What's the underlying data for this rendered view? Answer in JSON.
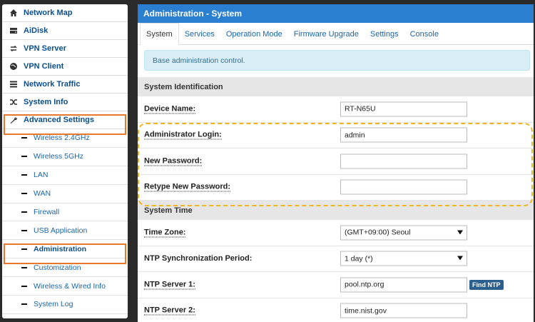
{
  "sidebar": {
    "items": [
      {
        "label": "Network Map",
        "icon": "home-icon"
      },
      {
        "label": "AiDisk",
        "icon": "disk-icon"
      },
      {
        "label": "VPN Server",
        "icon": "vpn-server-icon"
      },
      {
        "label": "VPN Client",
        "icon": "globe-icon"
      },
      {
        "label": "Network Traffic",
        "icon": "traffic-icon"
      },
      {
        "label": "System Info",
        "icon": "shuffle-icon"
      },
      {
        "label": "Advanced Settings",
        "icon": "wrench-icon"
      }
    ],
    "subitems": [
      {
        "label": "Wireless 2.4GHz"
      },
      {
        "label": "Wireless 5GHz"
      },
      {
        "label": "LAN"
      },
      {
        "label": "WAN"
      },
      {
        "label": "Firewall"
      },
      {
        "label": "USB Application"
      },
      {
        "label": "Administration"
      },
      {
        "label": "Customization"
      },
      {
        "label": "Wireless & Wired Info"
      },
      {
        "label": "System Log"
      }
    ]
  },
  "main": {
    "title": "Administration - System",
    "tabs": [
      "System",
      "Services",
      "Operation Mode",
      "Firmware Upgrade",
      "Settings",
      "Console"
    ],
    "info": "Base administration control.",
    "section1": "System Identification",
    "device_name_label": "Device Name:",
    "device_name_value": "RT-N65U",
    "admin_login_label": "Administrator Login:",
    "admin_login_value": "admin",
    "new_password_label": "New Password:",
    "retype_password_label": "Retype New Password:",
    "section2": "System Time",
    "timezone_label": "Time Zone:",
    "timezone_value": "(GMT+09:00) Seoul",
    "ntp_period_label": "NTP Synchronization Period:",
    "ntp_period_value": "1 day (*)",
    "ntp1_label": "NTP Server 1:",
    "ntp1_value": "pool.ntp.org",
    "find_ntp": "Find NTP",
    "ntp2_label": "NTP Server 2:",
    "ntp2_value": "time.nist.gov"
  },
  "colors": {
    "header": "#2a7fd0",
    "highlight": "#e8792c",
    "dashed": "#f2b51d",
    "info_bg": "#d9edf7"
  }
}
